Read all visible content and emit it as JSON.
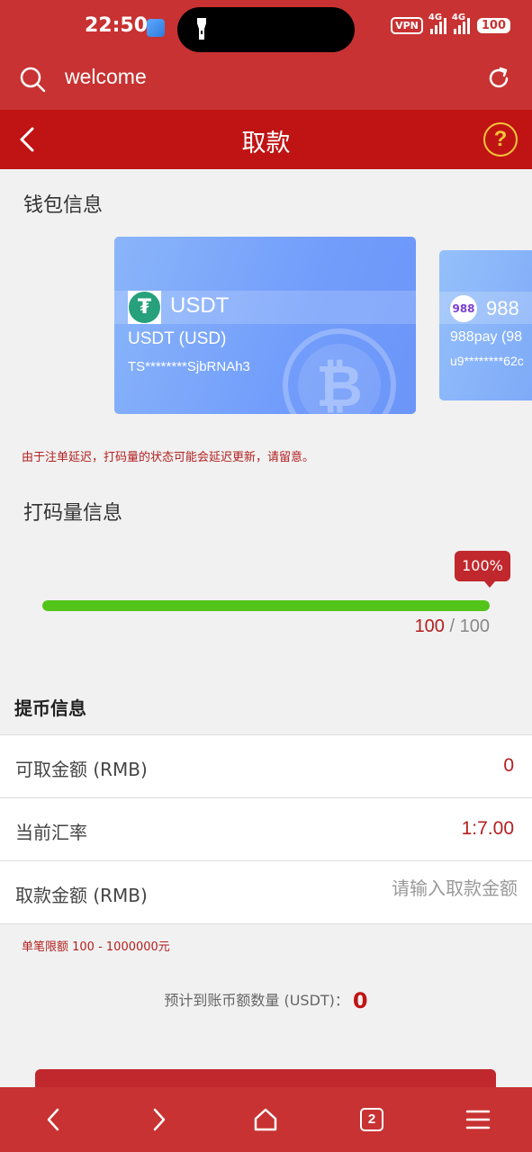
{
  "status_bar": {
    "time": "22:50",
    "vpn": "VPN",
    "network1": "4G",
    "network2": "4G",
    "battery": "100"
  },
  "browser": {
    "url": "welcome",
    "icons": {
      "search": "search-icon",
      "refresh": "refresh-icon"
    }
  },
  "header": {
    "title": "取款",
    "help": "?"
  },
  "wallet": {
    "section_title": "钱包信息",
    "cards": [
      {
        "name": "USDT",
        "sub": "USDT (USD)",
        "address": "TS********SjbRNAh3",
        "logo": "₮"
      },
      {
        "name": "988",
        "sub": "988pay (98",
        "address": "u9********62c",
        "logo": "988"
      }
    ],
    "notice": "由于注单延迟，打码量的状态可能会延迟更新，请留意。"
  },
  "turnover": {
    "section_title": "打码量信息",
    "percent_label": "100%",
    "progress": 1.0,
    "current": "100",
    "separator": "/",
    "total": "100"
  },
  "withdraw": {
    "section_title": "提币信息",
    "available_label": "可取金额 (RMB)",
    "available_value": "0",
    "rate_label": "当前汇率",
    "rate_value": "1:7.00",
    "amount_label": "取款金额 (RMB)",
    "amount_placeholder": "请输入取款金额",
    "amount_value": "",
    "limit_text": "单笔限额 100 - 1000000元",
    "estimate_label": "预计到账币额数量 (USDT)：",
    "estimate_value": "0"
  },
  "bottom_nav": {
    "tab_count": "2",
    "icons": [
      "back-icon",
      "forward-icon",
      "home-icon",
      "tabs-icon",
      "menu-icon"
    ]
  },
  "colors": {
    "browser_red": "#c83232",
    "header_red": "#c01414",
    "accent_red": "#b22020",
    "progress_green": "#52c41a",
    "help_yellow": "#f5c53a"
  }
}
